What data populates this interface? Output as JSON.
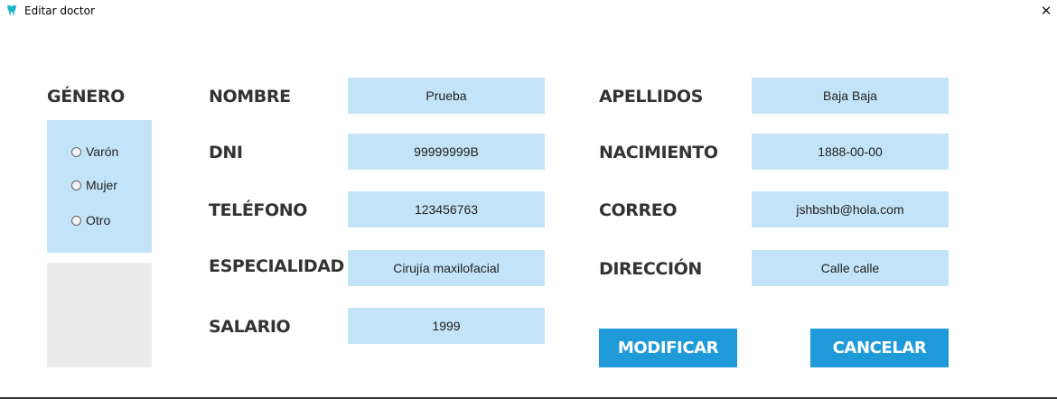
{
  "window": {
    "title": "Editar doctor",
    "close_glyph": "✕",
    "icon": "tooth-icon",
    "accent_color": "#1f9ad8",
    "field_color": "#c3e4f8"
  },
  "gender": {
    "label": "GÉNERO",
    "options": [
      "Varón",
      "Mujer",
      "Otro"
    ]
  },
  "fields": {
    "nombre": {
      "label": "NOMBRE",
      "value": "Prueba"
    },
    "dni": {
      "label": "DNI",
      "value": "99999999B"
    },
    "telefono": {
      "label": "TELÉFONO",
      "value": "123456763"
    },
    "especialidad": {
      "label": "ESPECIALIDAD",
      "value": "Cirujía maxilofacial"
    },
    "salario": {
      "label": "SALARIO",
      "value": "1999"
    },
    "apellidos": {
      "label": "APELLIDOS",
      "value": "Baja Baja"
    },
    "nacimiento": {
      "label": "NACIMIENTO",
      "value": "1888-00-00"
    },
    "correo": {
      "label": "CORREO",
      "value": "jshbshb@hola.com"
    },
    "direccion": {
      "label": "DIRECCIÓN",
      "value": "Calle calle"
    }
  },
  "buttons": {
    "modificar": "MODIFICAR",
    "cancelar": "CANCELAR"
  }
}
